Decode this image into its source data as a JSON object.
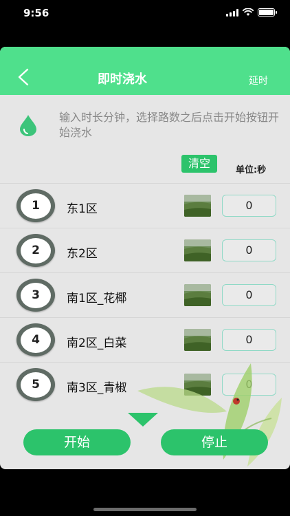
{
  "status_bar": {
    "time": "9:56"
  },
  "nav": {
    "title": "即时浇水",
    "right_action": "延时"
  },
  "hint": {
    "text": "输入时长分钟，选择路数之后点击开始按钮开始浇水"
  },
  "toolbar": {
    "clear_label": "清空",
    "unit_label": "单位:秒"
  },
  "zones": [
    {
      "number": "1",
      "name": "东1区",
      "duration": "0"
    },
    {
      "number": "2",
      "name": "东2区",
      "duration": "0"
    },
    {
      "number": "3",
      "name": "南1区_花椰",
      "duration": "0"
    },
    {
      "number": "4",
      "name": "南2区_白菜",
      "duration": "0"
    },
    {
      "number": "5",
      "name": "南3区_青椒",
      "duration": "0"
    }
  ],
  "actions": {
    "start_label": "开始",
    "stop_label": "停止"
  },
  "colors": {
    "accent": "#4fe08c",
    "button": "#2cc36b",
    "input_border": "#8fd9c6"
  },
  "icons": {
    "back": "chevron-left-icon",
    "hint": "water-drop-icon",
    "thumb": "field-image-icon",
    "expand": "triangle-down-icon"
  }
}
